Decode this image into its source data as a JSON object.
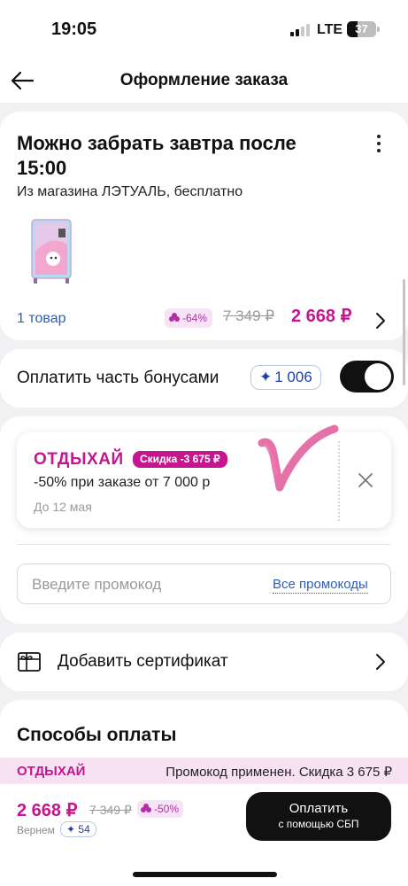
{
  "status_bar": {
    "time": "19:05",
    "network": "LTE",
    "battery": "37"
  },
  "header": {
    "title": "Оформление заказа"
  },
  "delivery": {
    "title": "Можно забрать завтра после 15:00",
    "subtitle": "Из магазина ЛЭТУАЛЬ, бесплатно",
    "items_link": "1 товар",
    "discount": "-64%",
    "old_price": "7 349 ₽",
    "new_price": "2 668 ₽"
  },
  "bonus": {
    "label": "Оплатить часть бонусами",
    "amount": "1 006",
    "toggle_on": true
  },
  "promo": {
    "code_name": "ОТДЫХАЙ",
    "badge": "Скидка -3 675 ₽",
    "description": "-50% при заказе от 7 000 р",
    "valid_until": "До 12 мая",
    "input_placeholder": "Введите промокод",
    "all_promos_link": "Все промокоды"
  },
  "certificate": {
    "label": "Добавить сертификат"
  },
  "payment": {
    "title": "Способы оплаты"
  },
  "banner": {
    "code": "ОТДЫХАЙ",
    "text": "Промокод применен. Скидка 3 675 ₽"
  },
  "bottom": {
    "total": "2 668 ₽",
    "old_total": "7 349 ₽",
    "discount": "-50%",
    "cashback_label": "Вернем",
    "cashback_amount": "54",
    "pay_line1": "Оплатить",
    "pay_line2": "с помощью СБП"
  },
  "colors": {
    "accent": "#c5158f",
    "link": "#2b5fb7",
    "bonus": "#1f3fa8"
  },
  "icons": [
    "back-arrow-icon",
    "kebab-menu-icon",
    "flower-icon",
    "chevron-right-icon",
    "star-icon",
    "close-icon",
    "certificate-icon"
  ]
}
